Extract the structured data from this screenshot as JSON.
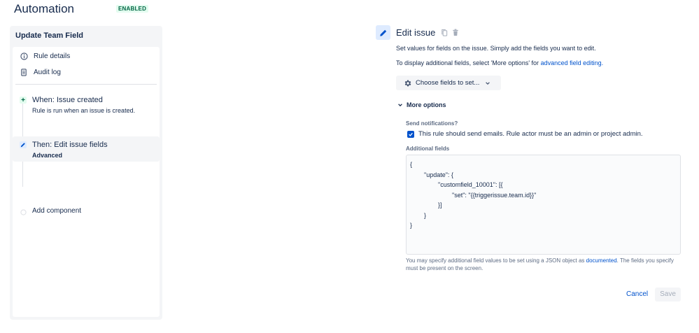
{
  "header": {
    "title": "Automation",
    "status": "ENABLED"
  },
  "sidebar": {
    "rule_name": "Update Team Field",
    "links": [
      {
        "label": "Rule details",
        "icon": "info-icon"
      },
      {
        "label": "Audit log",
        "icon": "document-icon"
      }
    ],
    "steps": [
      {
        "title": "When: Issue created",
        "subtitle": "Rule is run when an issue is created.",
        "icon": "plus-icon"
      },
      {
        "title": "Then: Edit issue fields",
        "subtitle": "Advanced",
        "icon": "pencil-icon",
        "selected": true
      },
      {
        "title": "Add component",
        "icon": "empty-circle-icon"
      }
    ]
  },
  "panel": {
    "title": "Edit issue",
    "description": "Set values for fields on the issue. Simply add the fields you want to edit.",
    "additional_prefix": "To display additional fields, select 'More options' for",
    "additional_link": "advanced field editing.",
    "choose_fields_label": "Choose fields to set...",
    "more_options_label": "More options",
    "notifications_label": "Send notifications?",
    "notifications_checkbox_label": "This rule should send emails. Rule actor must be an admin or project admin.",
    "notifications_checked": true,
    "additional_fields_label": "Additional fields",
    "json_lines": [
      "{",
      "        \"update\": {",
      "                \"customfield_10001\": [{",
      "                        \"set\": \"{{triggerissue.team.id}}\"",
      "                }]",
      "        }",
      "}"
    ],
    "help_prefix": "You may specify additional field values to be set using a JSON object as",
    "help_link": "documented",
    "help_suffix": ". The fields you specify must be present on the screen.",
    "cancel_label": "Cancel",
    "save_label": "Save"
  },
  "colors": {
    "accent": "#0052cc",
    "enabled_badge_bg": "#e3fcef",
    "enabled_badge_text": "#006644",
    "sidebar_bg": "#f4f5f7"
  }
}
